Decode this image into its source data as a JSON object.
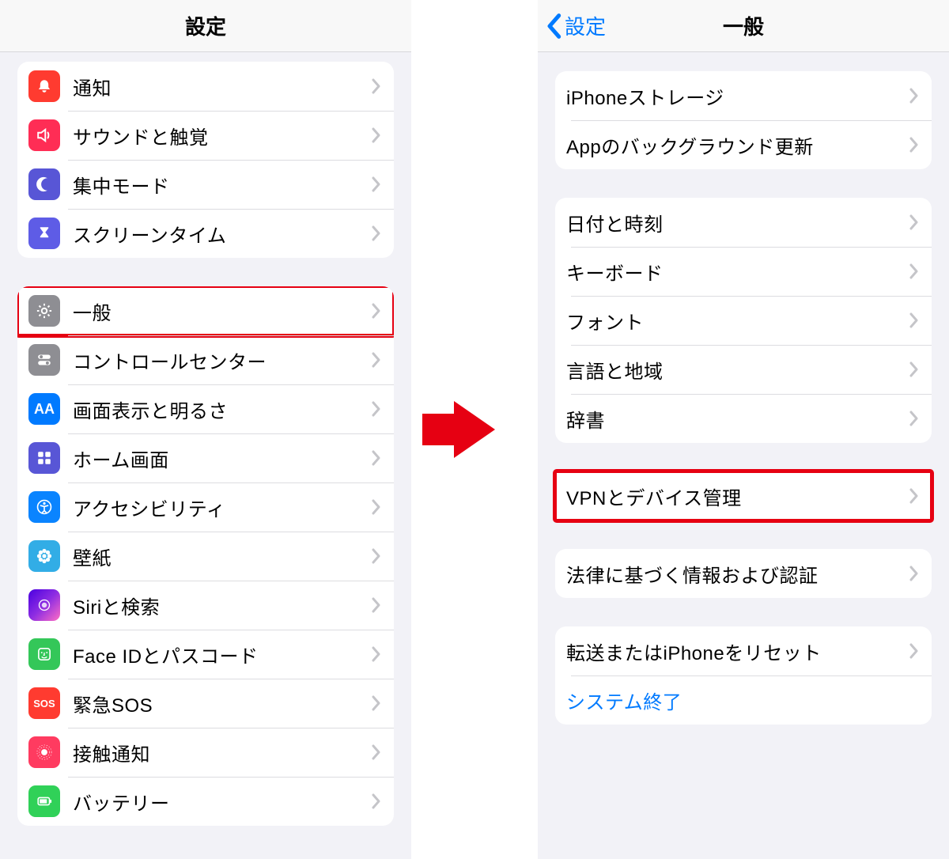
{
  "left": {
    "title": "設定",
    "groups": [
      [
        {
          "key": "notifications",
          "label": "通知",
          "icon": "bell-icon",
          "color": "ic-red"
        },
        {
          "key": "sound",
          "label": "サウンドと触覚",
          "icon": "speaker-icon",
          "color": "ic-pink"
        },
        {
          "key": "focus",
          "label": "集中モード",
          "icon": "moon-icon",
          "color": "ic-purple"
        },
        {
          "key": "screentime",
          "label": "スクリーンタイム",
          "icon": "hourglass-icon",
          "color": "ic-purple2"
        }
      ],
      [
        {
          "key": "general",
          "label": "一般",
          "icon": "gear-icon",
          "color": "ic-gray",
          "highlight": true
        },
        {
          "key": "control",
          "label": "コントロールセンター",
          "icon": "toggles-icon",
          "color": "ic-gray2"
        },
        {
          "key": "display",
          "label": "画面表示と明るさ",
          "icon": "aa-icon",
          "color": "ic-blue"
        },
        {
          "key": "home",
          "label": "ホーム画面",
          "icon": "grid-icon",
          "color": "ic-home"
        },
        {
          "key": "accessibility",
          "label": "アクセシビリティ",
          "icon": "accessibility-icon",
          "color": "ic-blue2"
        },
        {
          "key": "wallpaper",
          "label": "壁紙",
          "icon": "flower-icon",
          "color": "ic-cyan"
        },
        {
          "key": "siri",
          "label": "Siriと検索",
          "icon": "siri-icon",
          "color": "ic-siri"
        },
        {
          "key": "faceid",
          "label": "Face IDとパスコード",
          "icon": "faceid-icon",
          "color": "ic-green"
        },
        {
          "key": "sos",
          "label": "緊急SOS",
          "icon": "sos-icon",
          "color": "ic-sos"
        },
        {
          "key": "exposure",
          "label": "接触通知",
          "icon": "exposure-icon",
          "color": "ic-expose"
        },
        {
          "key": "battery",
          "label": "バッテリー",
          "icon": "battery-icon",
          "color": "ic-green2"
        }
      ]
    ]
  },
  "right": {
    "title": "一般",
    "back": "設定",
    "groups": [
      [
        {
          "key": "storage",
          "label": "iPhoneストレージ"
        },
        {
          "key": "bgref",
          "label": "Appのバックグラウンド更新"
        }
      ],
      [
        {
          "key": "datetime",
          "label": "日付と時刻"
        },
        {
          "key": "keyboard",
          "label": "キーボード"
        },
        {
          "key": "fonts",
          "label": "フォント"
        },
        {
          "key": "lang",
          "label": "言語と地域"
        },
        {
          "key": "dict",
          "label": "辞書"
        }
      ],
      [
        {
          "key": "vpn",
          "label": "VPNとデバイス管理",
          "highlight": true
        }
      ],
      [
        {
          "key": "legal",
          "label": "法律に基づく情報および認証"
        }
      ],
      [
        {
          "key": "transfer",
          "label": "転送またはiPhoneをリセット"
        },
        {
          "key": "shutdown",
          "label": "システム終了",
          "link": true,
          "nochevron": true
        }
      ]
    ]
  }
}
